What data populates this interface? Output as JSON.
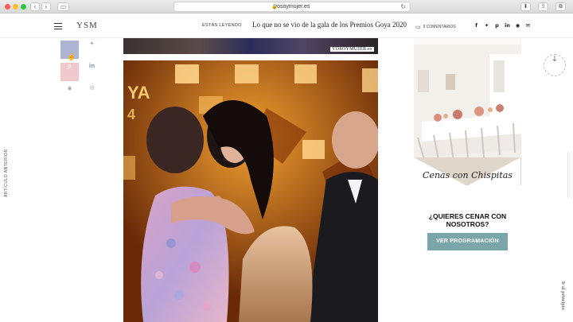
{
  "browser": {
    "url": "yosoymujer.es"
  },
  "site": {
    "logo": "YSM",
    "reading_label": "ESTÁS LEYENDO",
    "article_title": "Lo que no se vio de la gala de los Premios Goya 2020",
    "comments_label": "9 COMENTARIOS",
    "share_icons": [
      "f",
      "t",
      "p",
      "in",
      "wa",
      "mail"
    ]
  },
  "left_rail": {
    "prev_article": "ARTÍCULO ANTERIOR"
  },
  "share_buttons": {
    "facebook": "f",
    "twitter": "t",
    "pinterest": "p",
    "linkedin": "in",
    "whatsapp": "wa",
    "email": "mail"
  },
  "article": {
    "watermark": "YOSOYMUJER.es",
    "photo_text_1": "YA",
    "photo_text_2": "4"
  },
  "ad": {
    "script_title": "Cenas con Chispitas",
    "question": "¿QUIERES CENAR CON NOSOTROS?",
    "button_label": "VER PROGRAMACIÓN",
    "accent_color": "#7aa6a9"
  },
  "right_rail": {
    "back_to_top": "Ir al principio"
  }
}
